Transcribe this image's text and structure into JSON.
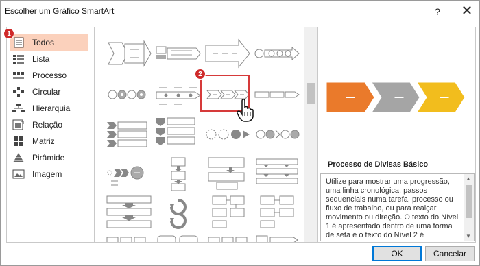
{
  "dialog": {
    "title": "Escolher um Gráfico SmartArt",
    "help_label": "?",
    "close_label": "✕"
  },
  "badges": {
    "first": "1",
    "second": "2"
  },
  "categories": [
    {
      "label": "Todos",
      "icon": "all-icon",
      "selected": true
    },
    {
      "label": "Lista",
      "icon": "list-icon"
    },
    {
      "label": "Processo",
      "icon": "process-icon"
    },
    {
      "label": "Circular",
      "icon": "cycle-icon"
    },
    {
      "label": "Hierarquia",
      "icon": "hierarchy-icon"
    },
    {
      "label": "Relação",
      "icon": "relationship-icon"
    },
    {
      "label": "Matriz",
      "icon": "matrix-icon"
    },
    {
      "label": "Pirâmide",
      "icon": "pyramid-icon"
    },
    {
      "label": "Imagem",
      "icon": "picture-icon"
    }
  ],
  "preview": {
    "title": "Processo de Divisas Básico",
    "description": "Utilize para mostrar uma progressão, uma linha cronológica, passos sequenciais numa tarefa, processo ou fluxo de trabalho, ou para realçar movimento ou direção. O texto do Nível 1 é apresentado dentro de uma forma de seta e o texto do Nível 2 é",
    "chevron_colors": [
      "#ea7a2b",
      "#a5a5a5",
      "#f2bd1d"
    ],
    "chevron_text": "—"
  },
  "buttons": {
    "ok": "OK",
    "cancel": "Cancelar"
  }
}
